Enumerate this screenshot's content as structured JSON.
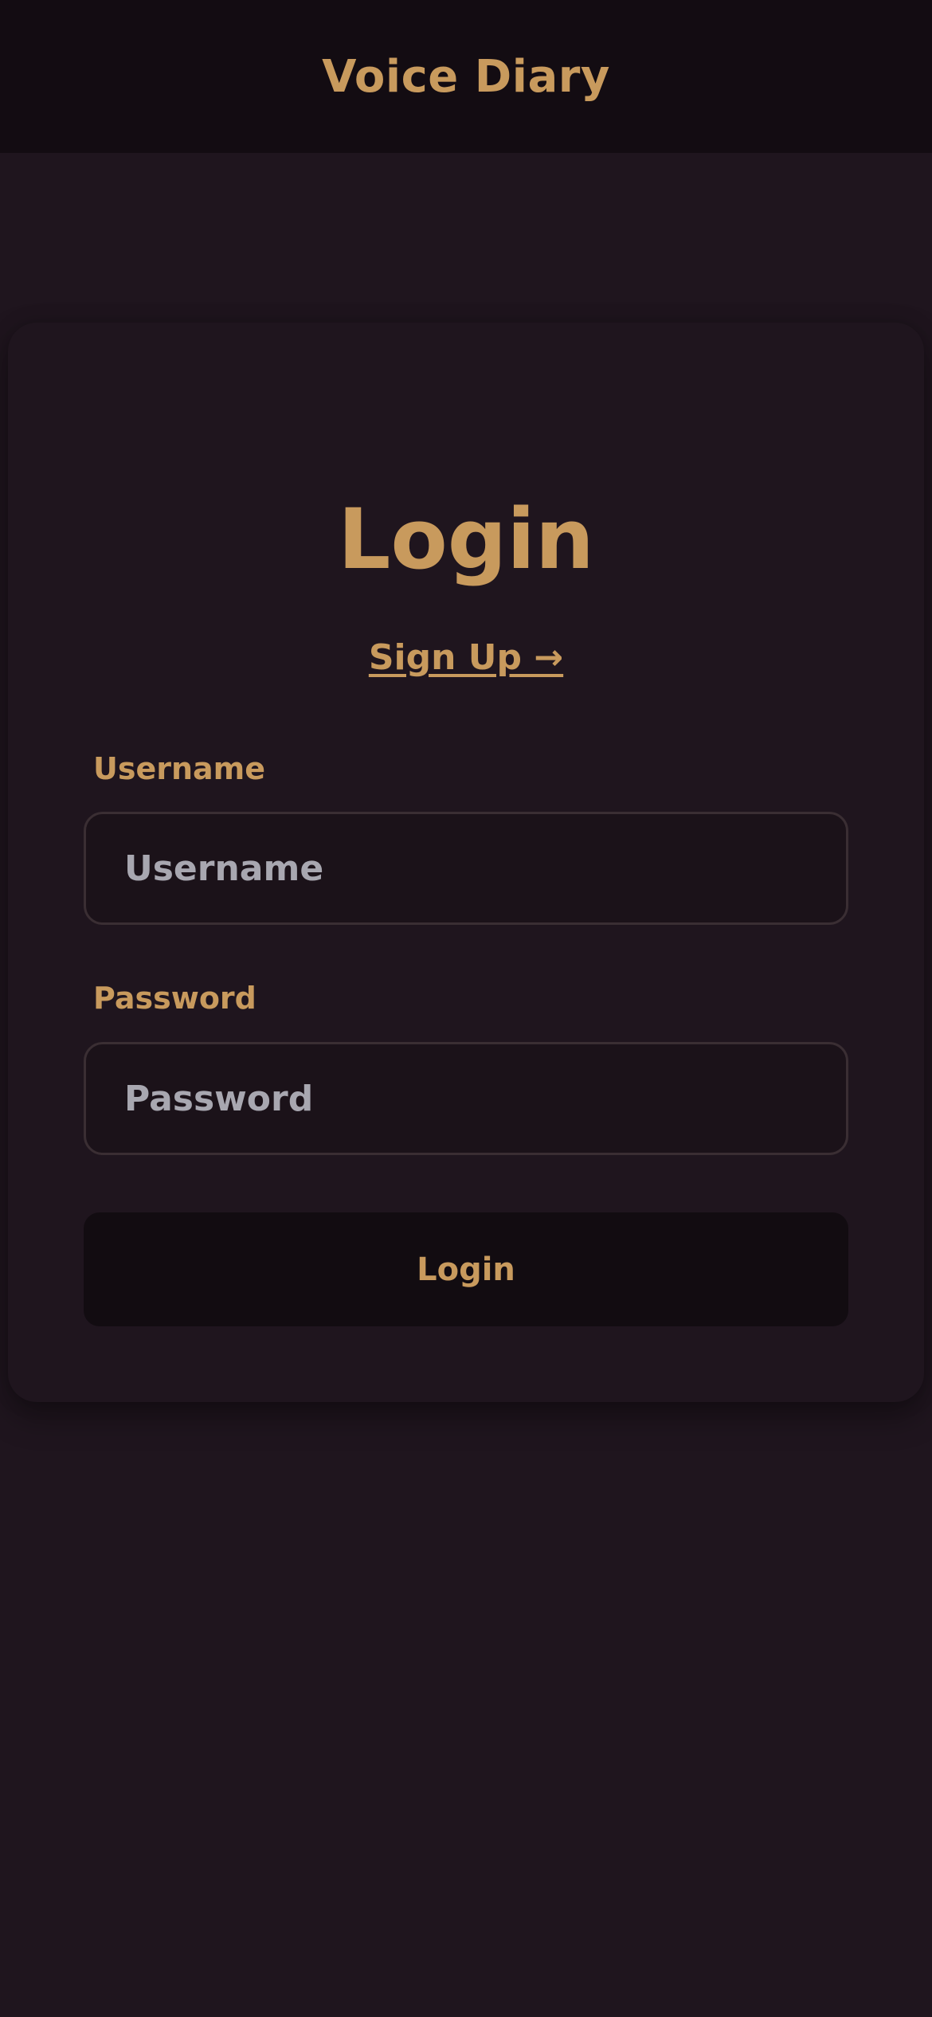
{
  "header": {
    "title": "Voice Diary"
  },
  "login_card": {
    "title": "Login",
    "signup_link": "Sign Up →",
    "username": {
      "label": "Username",
      "placeholder": "Username",
      "value": ""
    },
    "password": {
      "label": "Password",
      "placeholder": "Password",
      "value": ""
    },
    "login_button": "Login"
  },
  "colors": {
    "background": "#1f151e",
    "header_background": "#130c12",
    "accent": "#c89a5d",
    "placeholder_text": "#a8a7b0",
    "input_border": "#3a2e33",
    "button_background": "#120c11"
  }
}
